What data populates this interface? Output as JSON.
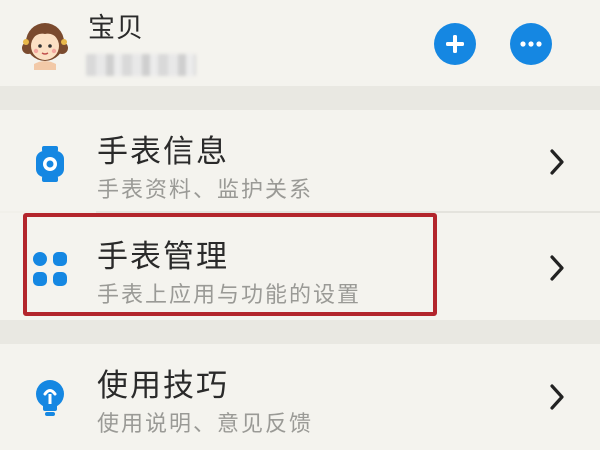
{
  "profile": {
    "name": "宝贝",
    "id_text": "",
    "add_label": "+",
    "more_label": "···"
  },
  "menu": {
    "items": [
      {
        "title": "手表信息",
        "subtitle": "手表资料、监护关系",
        "icon": "watch-icon"
      },
      {
        "title": "手表管理",
        "subtitle": "手表上应用与功能的设置",
        "icon": "apps-grid-icon"
      },
      {
        "title": "使用技巧",
        "subtitle": "使用说明、意见反馈",
        "icon": "lightbulb-icon"
      }
    ]
  },
  "colors": {
    "accent": "#1587e2",
    "highlight": "#b3252c",
    "background": "#f1f0ea"
  }
}
